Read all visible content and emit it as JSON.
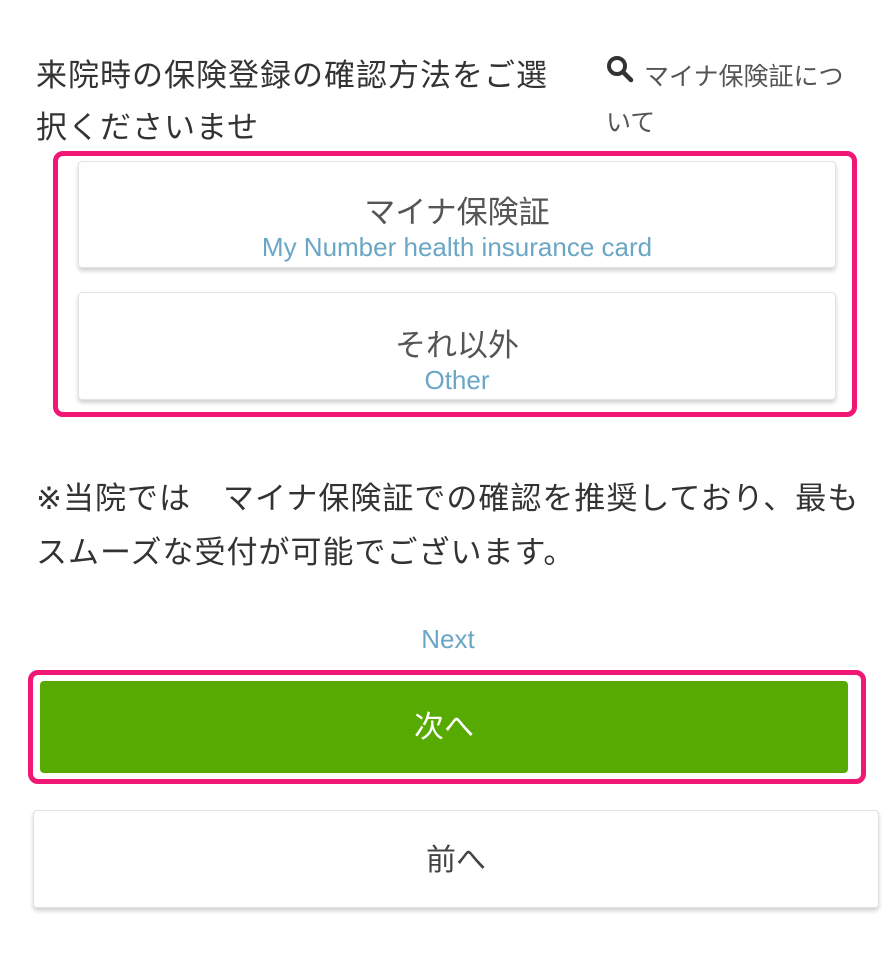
{
  "question": {
    "text": "来院時の保険登録の確認方法をご選択くださいませ"
  },
  "help_link": {
    "icon": "search-icon",
    "text": "マイナ保険証について"
  },
  "options": [
    {
      "label_ja": "マイナ保険証",
      "label_en": "My Number health insurance card"
    },
    {
      "label_ja": "それ以外",
      "label_en": "Other"
    }
  ],
  "notice": {
    "text": "※当院では　マイナ保険証での確認を推奨しており、最もスムーズな受付が可能でございます。"
  },
  "next": {
    "caption": "Next",
    "label": "次へ"
  },
  "prev": {
    "label": "前へ"
  },
  "colors": {
    "highlight_border": "#f01874",
    "next_button_bg": "#57aa01",
    "english_text": "#6aa6c6"
  }
}
